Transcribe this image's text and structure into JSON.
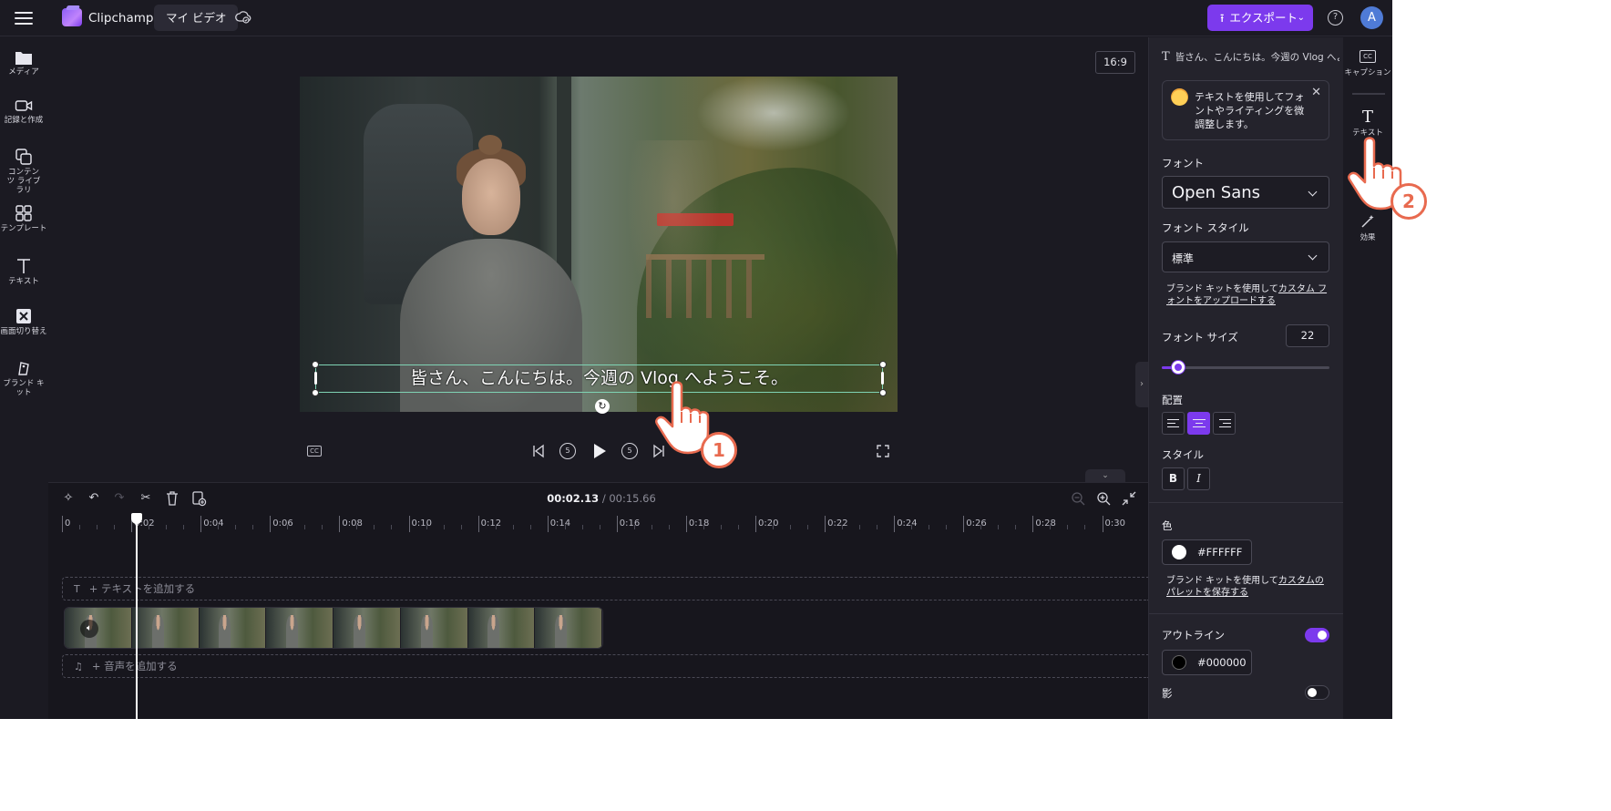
{
  "header": {
    "app_name": "Clipchamp",
    "project_button": "マイ ビデオ",
    "export_button": "エクスポート",
    "avatar_initial": "A",
    "brand_color": "#7c3aed"
  },
  "left_sidebar": {
    "items": [
      {
        "label": "メディア",
        "icon": "folder-icon"
      },
      {
        "label": "記録と作成",
        "icon": "camera-icon"
      },
      {
        "label": "コンテンツ ライブラリ",
        "icon": "library-icon"
      },
      {
        "label": "テンプレート",
        "icon": "template-icon"
      },
      {
        "label": "テキスト",
        "icon": "text-icon"
      },
      {
        "label": "画面切り替え",
        "icon": "transition-icon"
      },
      {
        "label": "ブランド キット",
        "icon": "brand-kit-icon"
      }
    ]
  },
  "preview": {
    "aspect_ratio": "16:9",
    "caption_text": "皆さん、こんにちは。今週の Vlog へようこそ。"
  },
  "playback": {
    "skip_back_seconds": "5",
    "skip_forward_seconds": "5"
  },
  "timeline": {
    "current_time": "00:02.13",
    "total_time": "/ 00:15.66",
    "ruler_labels": [
      "0",
      "0:02",
      "0:04",
      "0:06",
      "0:08",
      "0:10",
      "0:12",
      "0:14",
      "0:16",
      "0:18",
      "0:20",
      "0:22",
      "0:24",
      "0:26",
      "0:28",
      "0:30"
    ],
    "add_text_track": "+ テキストを追加する",
    "add_audio_track": "+ 音声を追加する"
  },
  "properties": {
    "title": "皆さん、こんにちは。今週の Vlog へよ...",
    "tip_text": "テキストを使用してフォントやライティングを微調整します。",
    "font_label": "フォント",
    "font_value": "Open Sans",
    "font_style_label": "フォント スタイル",
    "font_style_value": "標準",
    "brand_font_link_prefix": "ブランド キットを使用して",
    "brand_font_link": "カスタム フォントをアップロードする",
    "font_size_label": "フォント サイズ",
    "font_size_value": "22",
    "font_size_slider_fraction": 0.1,
    "alignment_label": "配置",
    "alignment_selected": "center",
    "style_label": "スタイル",
    "bold_label": "B",
    "italic_label": "I",
    "color_label": "色",
    "color_value": "#FFFFFF",
    "brand_palette_link_prefix": "ブランド キットを使用して",
    "brand_palette_link": "カスタムのパレットを保存する",
    "outline_label": "アウトライン",
    "outline_enabled": true,
    "outline_color": "#000000",
    "shadow_label": "影",
    "shadow_enabled": false
  },
  "right_rail": {
    "items": [
      {
        "label": "キャプション",
        "icon": "captions-icon"
      },
      {
        "label": "テキスト",
        "icon": "text-icon"
      },
      {
        "label": "効果",
        "icon": "effects-icon"
      }
    ]
  },
  "tutorial": {
    "step1": "1",
    "step2": "2",
    "accent_color": "#e86a4f"
  }
}
